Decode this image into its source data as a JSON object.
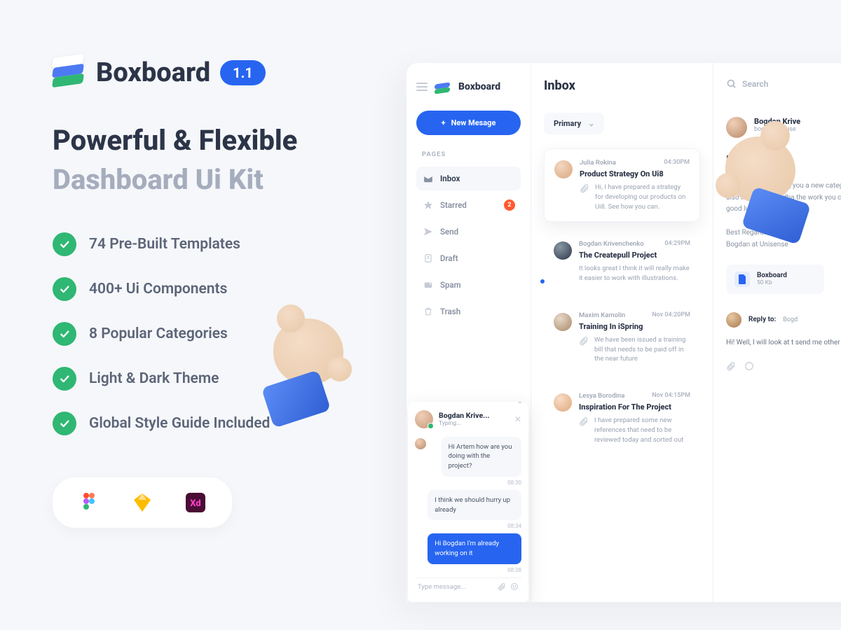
{
  "brand": {
    "name": "Boxboard",
    "version": "1.1"
  },
  "headline": "Powerful & Flexible",
  "subheadline": "Dashboard Ui Kit",
  "features": [
    "74 Pre-Built Templates",
    "400+ Ui Components",
    "8 Popular Categories",
    "Light & Dark Theme",
    "Global Style Guide Included"
  ],
  "dashboard": {
    "sidebar": {
      "brand": "Boxboard",
      "newMessage": "New Mesage",
      "sectionLabel": "PAGES",
      "items": [
        {
          "label": "Inbox",
          "active": true
        },
        {
          "label": "Starred",
          "badge": "2"
        },
        {
          "label": "Send"
        },
        {
          "label": "Draft"
        },
        {
          "label": "Spam"
        },
        {
          "label": "Trash"
        }
      ]
    },
    "chatPopup": {
      "name": "Bogdan Krive...",
      "status": "Typing...",
      "messages": [
        {
          "text": "Hi Artem how are you doing with the project?",
          "time": "08:30",
          "from": "in"
        },
        {
          "text": "I think we should hurry up already",
          "time": "08:34",
          "from": "in"
        },
        {
          "text": "Hi Bogdan I'm already working on it",
          "time": "08:38",
          "from": "out"
        }
      ],
      "inputPlaceholder": "Type message..."
    },
    "inbox": {
      "title": "Inbox",
      "searchPlaceholder": "Search",
      "dropdown": "Primary",
      "mails": [
        {
          "sender": "Julia Rokina",
          "time": "04:30PM",
          "subject": "Product Strategy On Ui8",
          "preview": "Hi, I have prepared a strategy for developing our products on Ui8. See how you can."
        },
        {
          "sender": "Bogdan Krivenchenko",
          "time": "04:29PM",
          "subject": "The Createpull Project",
          "preview": "It looks great I think it will really make it easier to work with illustrations.",
          "unread": true
        },
        {
          "sender": "Maxim Kamolin",
          "time": "Nov 04:20PM",
          "subject": "Training In iSpring",
          "preview": "We have been issued a training bill that needs to be paid off in the near future"
        },
        {
          "sender": "Lesya Borodina",
          "time": "Nov 04:15PM",
          "subject": "Inspiration For The Project",
          "preview": "I have prepared some new references that need to be reviewed today and sorted out"
        }
      ]
    },
    "detail": {
      "sender": "Bogdan Krive",
      "email": "bogdan@unise",
      "subjectStub": "Da",
      "body": "As you already know, you a new category of also like to get feedba the work you can sen good luck and pleasa",
      "signoff1": "Best Regards,",
      "signoff2": "Bogdan at Unisense",
      "attachment": {
        "name": "Boxboard",
        "size": "50 Kb"
      },
      "reply": {
        "label": "Reply to:",
        "to": "Bogd",
        "body": "Hi! Well, I will look at t send me other files o"
      }
    }
  }
}
